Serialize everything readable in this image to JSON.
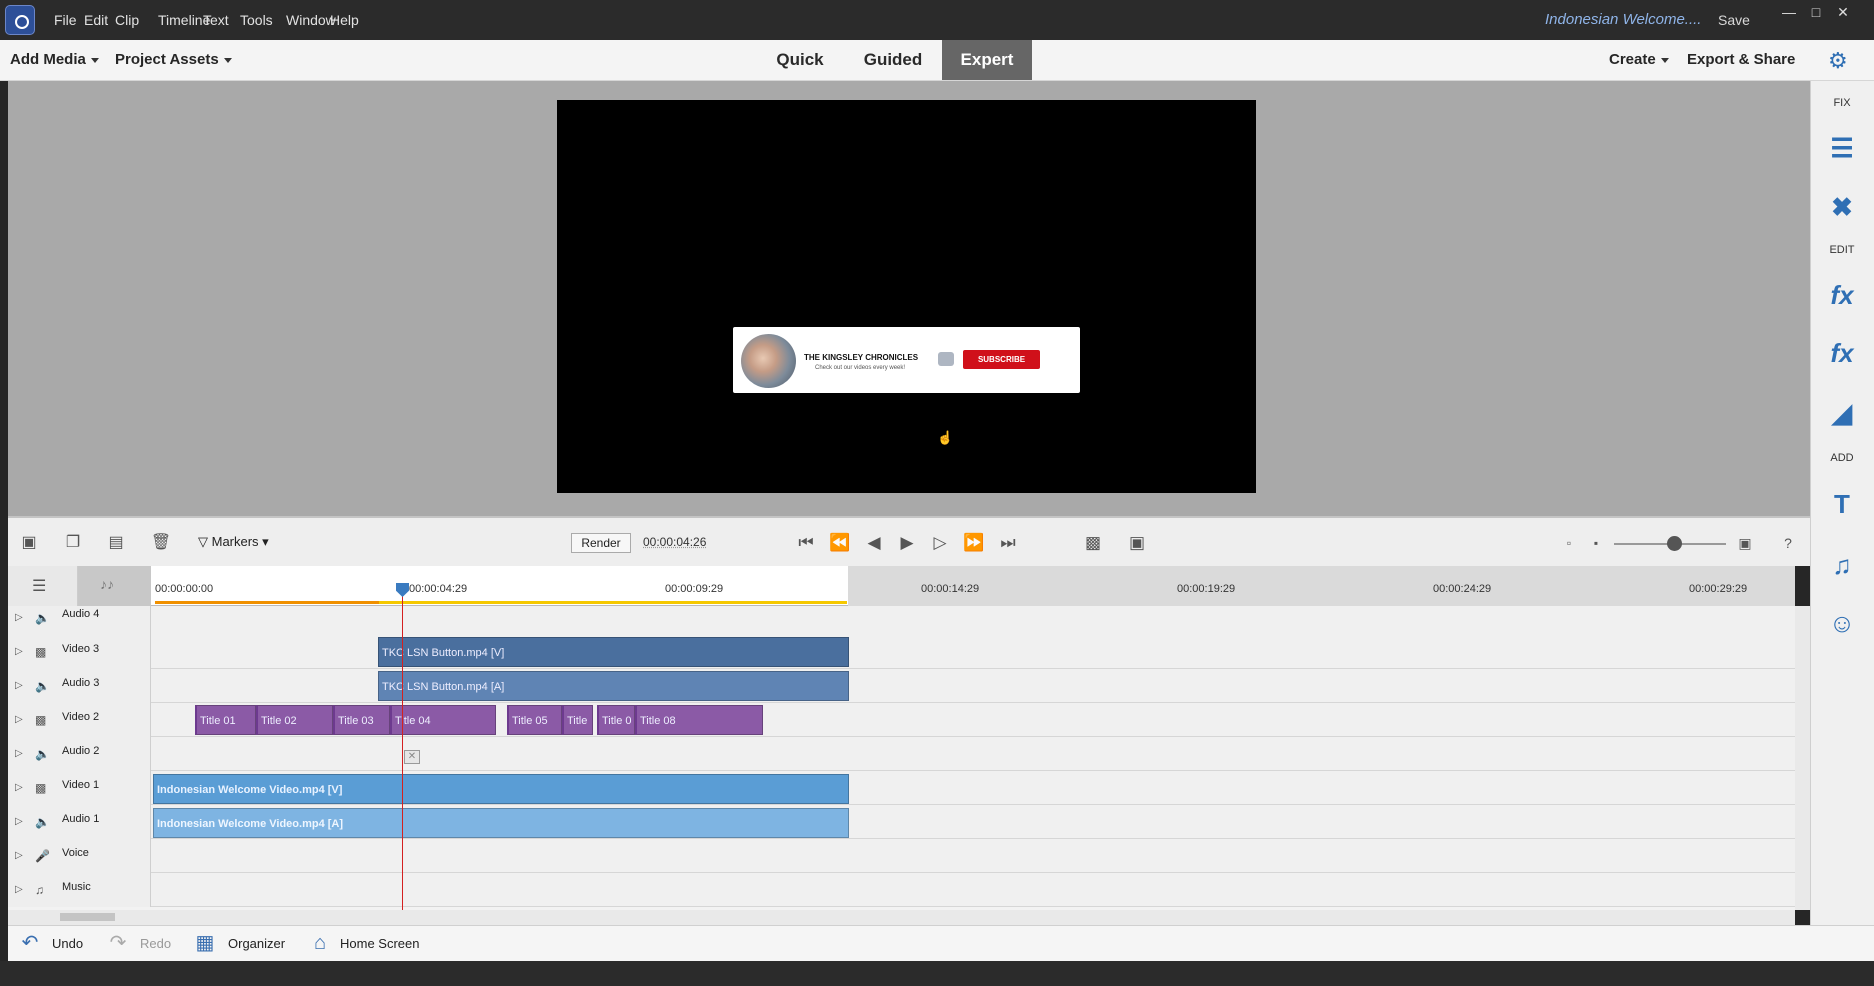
{
  "app": {
    "doc_title": "Indonesian Welcome....",
    "save_label": "Save"
  },
  "menu": [
    "File",
    "Edit",
    "Clip",
    "Timeline",
    "Text",
    "Tools",
    "Window",
    "Help"
  ],
  "toolbar": {
    "add_media": "Add Media",
    "project_assets": "Project Assets",
    "modes": [
      "Quick",
      "Guided",
      "Expert"
    ],
    "active_mode": "Expert",
    "create": "Create",
    "export_share": "Export & Share"
  },
  "preview": {
    "banner_title": "THE KINGSLEY CHRONICLES",
    "banner_sub": "Check out our videos every week!",
    "subscribe": "SUBSCRIBE"
  },
  "right_panel": {
    "fix_label": "FIX",
    "edit_label": "EDIT",
    "add_label": "ADD"
  },
  "timeline": {
    "markers_label": "Markers",
    "render_label": "Render",
    "current_time": "00:00:04:26",
    "ruler_ticks": [
      "00:00:00:00",
      "00:00:04:29",
      "00:00:09:29",
      "00:00:14:29",
      "00:00:19:29",
      "00:00:24:29",
      "00:00:29:29"
    ],
    "tracks": [
      "Audio 4",
      "Video 3",
      "Audio 3",
      "Video 2",
      "Audio 2",
      "Video 1",
      "Audio 1",
      "Voice",
      "Music"
    ],
    "clips": {
      "video3": "TKC LSN Button.mp4 [V]",
      "audio3": "TKC LSN Button.mp4 [A]",
      "titles": [
        "Title 01",
        "Title 02",
        "Title 03",
        "Title 04",
        "Title 05",
        "Title",
        "Title 0",
        "Title 08"
      ],
      "video1": "Indonesian Welcome Video.mp4 [V]",
      "audio1": "Indonesian Welcome Video.mp4 [A]"
    }
  },
  "bottom": {
    "undo": "Undo",
    "redo": "Redo",
    "organizer": "Organizer",
    "home": "Home Screen"
  },
  "colors": {
    "accent": "#2f6fb4",
    "playhead": "#d42020",
    "title_clip": "#8b5aa6",
    "video1_clip": "#5a9dd5"
  }
}
